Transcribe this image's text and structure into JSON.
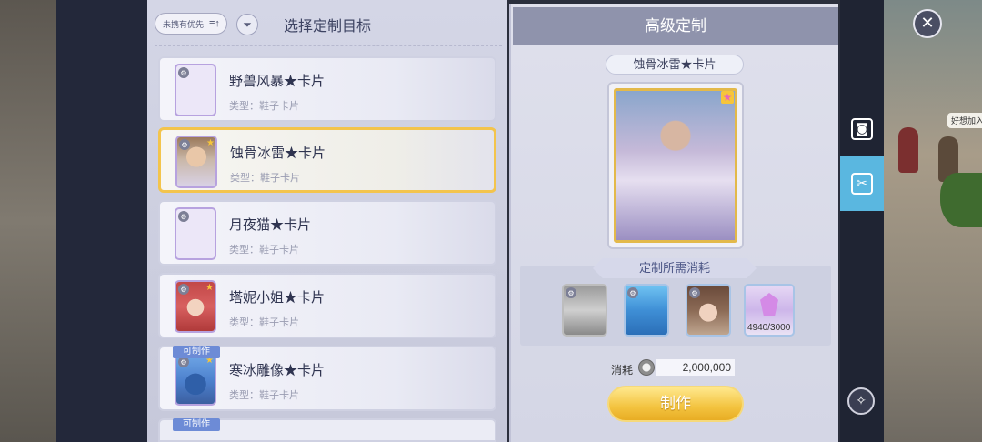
{
  "list_panel": {
    "priority_button": "未携有优先",
    "title": "选择定制目标",
    "cards": [
      {
        "name": "野兽风暴★卡片",
        "type": "类型：鞋子卡片",
        "has_portrait": false,
        "craftable": false
      },
      {
        "name": "蚀骨冰雷★卡片",
        "type": "类型：鞋子卡片",
        "has_portrait": true,
        "craftable": false,
        "selected": true
      },
      {
        "name": "月夜猫★卡片",
        "type": "类型：鞋子卡片",
        "has_portrait": false,
        "craftable": false
      },
      {
        "name": "塔妮小姐★卡片",
        "type": "类型：鞋子卡片",
        "has_portrait": true,
        "craftable": false
      },
      {
        "name": "寒冰雕像★卡片",
        "type": "类型：鞋子卡片",
        "has_portrait": true,
        "craftable": true,
        "craft_tag": "可制作"
      }
    ],
    "partial_tag": "可制作"
  },
  "detail_panel": {
    "header": "高级定制",
    "selected_name": "蚀骨冰雷★卡片",
    "cost_title": "定制所需消耗",
    "materials": [
      {
        "name": "grey-hero-card",
        "icon": "card-icon"
      },
      {
        "name": "ice-statue-card",
        "icon": "card-icon"
      },
      {
        "name": "girl-card",
        "icon": "card-icon"
      },
      {
        "name": "crystal-shard",
        "icon": "crystal-icon",
        "count": "4940/3000"
      }
    ],
    "fee_label": "消耗",
    "fee_value": "2,000,000",
    "make_button": "制作"
  },
  "scene": {
    "speech_bubble": "好想加入"
  },
  "colors": {
    "accent_gold": "#f3c44c",
    "header_bg": "#8f93ac",
    "active_tab": "#5ab7e0"
  }
}
